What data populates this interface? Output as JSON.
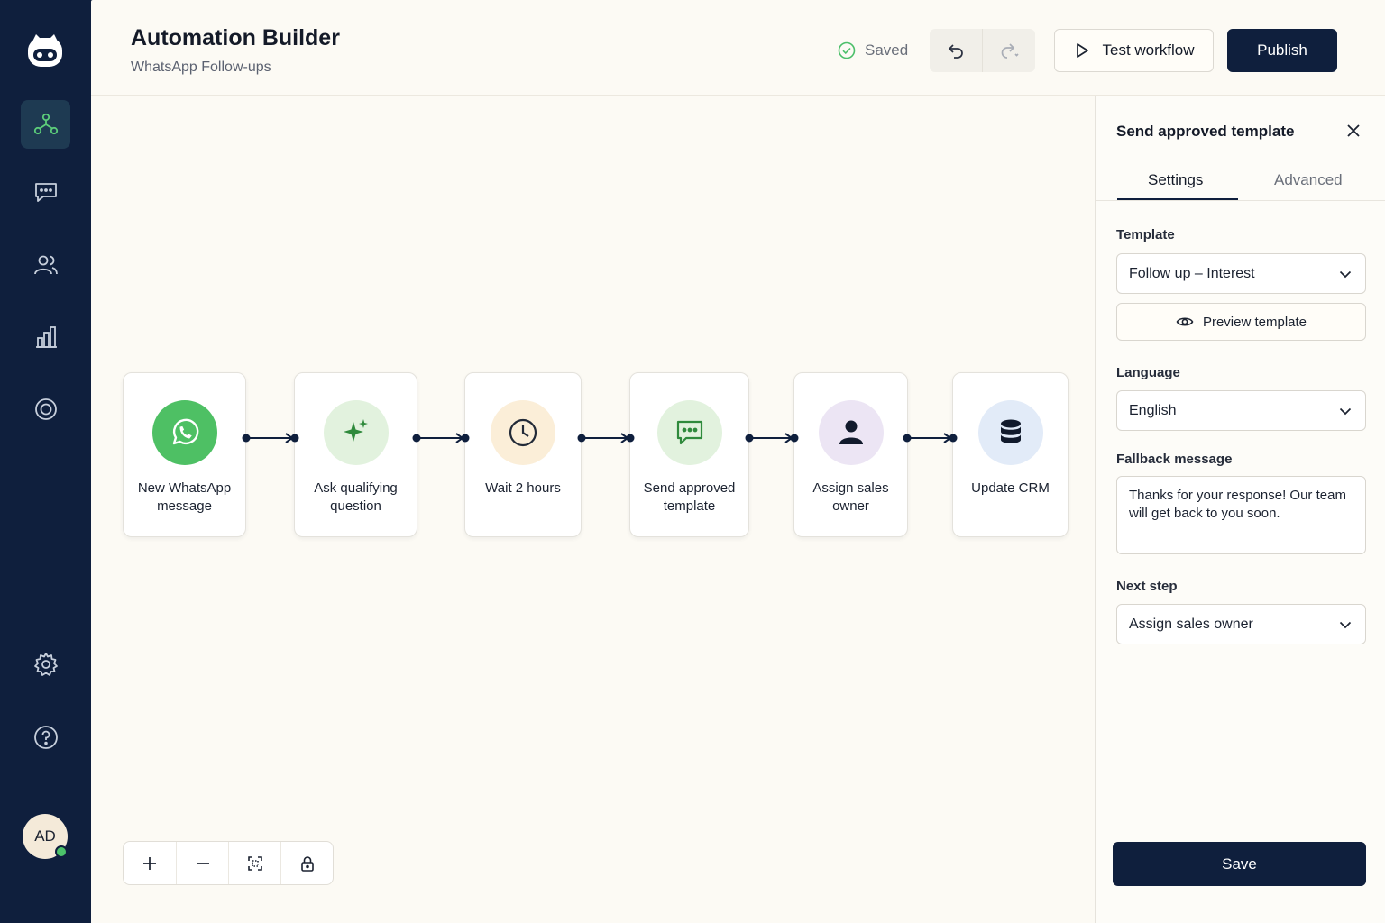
{
  "header": {
    "title": "Automation Builder",
    "subtitle": "WhatsApp Follow-ups",
    "saved_label": "Saved",
    "test_label": "Test workflow",
    "publish_label": "Publish"
  },
  "sidebar": {
    "items": [
      {
        "icon": "workflow-icon",
        "active": true
      },
      {
        "icon": "chat-icon",
        "active": false
      },
      {
        "icon": "users-icon",
        "active": false
      },
      {
        "icon": "analytics-icon",
        "active": false
      },
      {
        "icon": "target-icon",
        "active": false
      },
      {
        "icon": "gear-icon",
        "active": false
      },
      {
        "icon": "help-icon",
        "active": false
      }
    ],
    "avatar_initials": "AD"
  },
  "workflow": {
    "nodes": [
      {
        "label": "New WhatsApp message",
        "icon": "whatsapp-icon",
        "color": "#4ec064"
      },
      {
        "label": "Ask qualifying question",
        "icon": "sparkle-icon",
        "color": "#e2f2de"
      },
      {
        "label": "Wait 2 hours",
        "icon": "clock-icon",
        "color": "#fbeed8"
      },
      {
        "label": "Send approved template",
        "icon": "message-icon",
        "color": "#e2f2de"
      },
      {
        "label": "Assign sales owner",
        "icon": "person-icon",
        "color": "#ece5f4"
      },
      {
        "label": "Update CRM",
        "icon": "database-icon",
        "color": "#e2ebf8"
      }
    ]
  },
  "panel": {
    "title": "Send approved template",
    "tabs": [
      "Settings",
      "Advanced"
    ],
    "template_label": "Template",
    "template_value": "Follow up – Interest",
    "preview_label": "Preview template",
    "language_label": "Language",
    "language_value": "English",
    "fallback_label": "Fallback message",
    "fallback_value": "Thanks for your response! Our team will get back to you soon.",
    "next_step_label": "Next step",
    "next_step_value": "Assign sales owner",
    "save_label": "Save"
  },
  "colors": {
    "navy": "#0f1f3d",
    "accent_green": "#4cc36a",
    "canvas_bg": "#fcfaf4"
  }
}
